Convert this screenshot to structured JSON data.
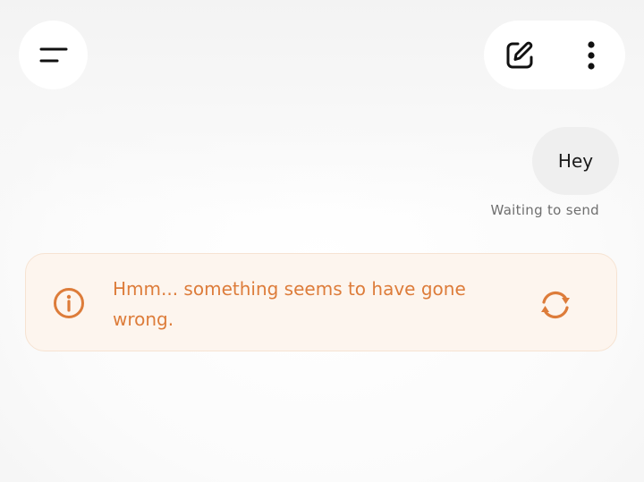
{
  "header": {
    "menu_icon": "menu-icon",
    "compose_icon": "compose-icon",
    "more_icon": "more-vertical-icon"
  },
  "conversation": {
    "messages": [
      {
        "role": "user",
        "text": "Hey",
        "status": "Waiting to send"
      }
    ]
  },
  "error_banner": {
    "icon": "info-icon",
    "message": "Hmm... something seems to have gone wrong.",
    "retry_icon": "refresh-icon"
  },
  "colors": {
    "error_accent": "#dd7c3a",
    "error_bg": "#fdf5ee",
    "bubble_bg": "#efefef"
  }
}
